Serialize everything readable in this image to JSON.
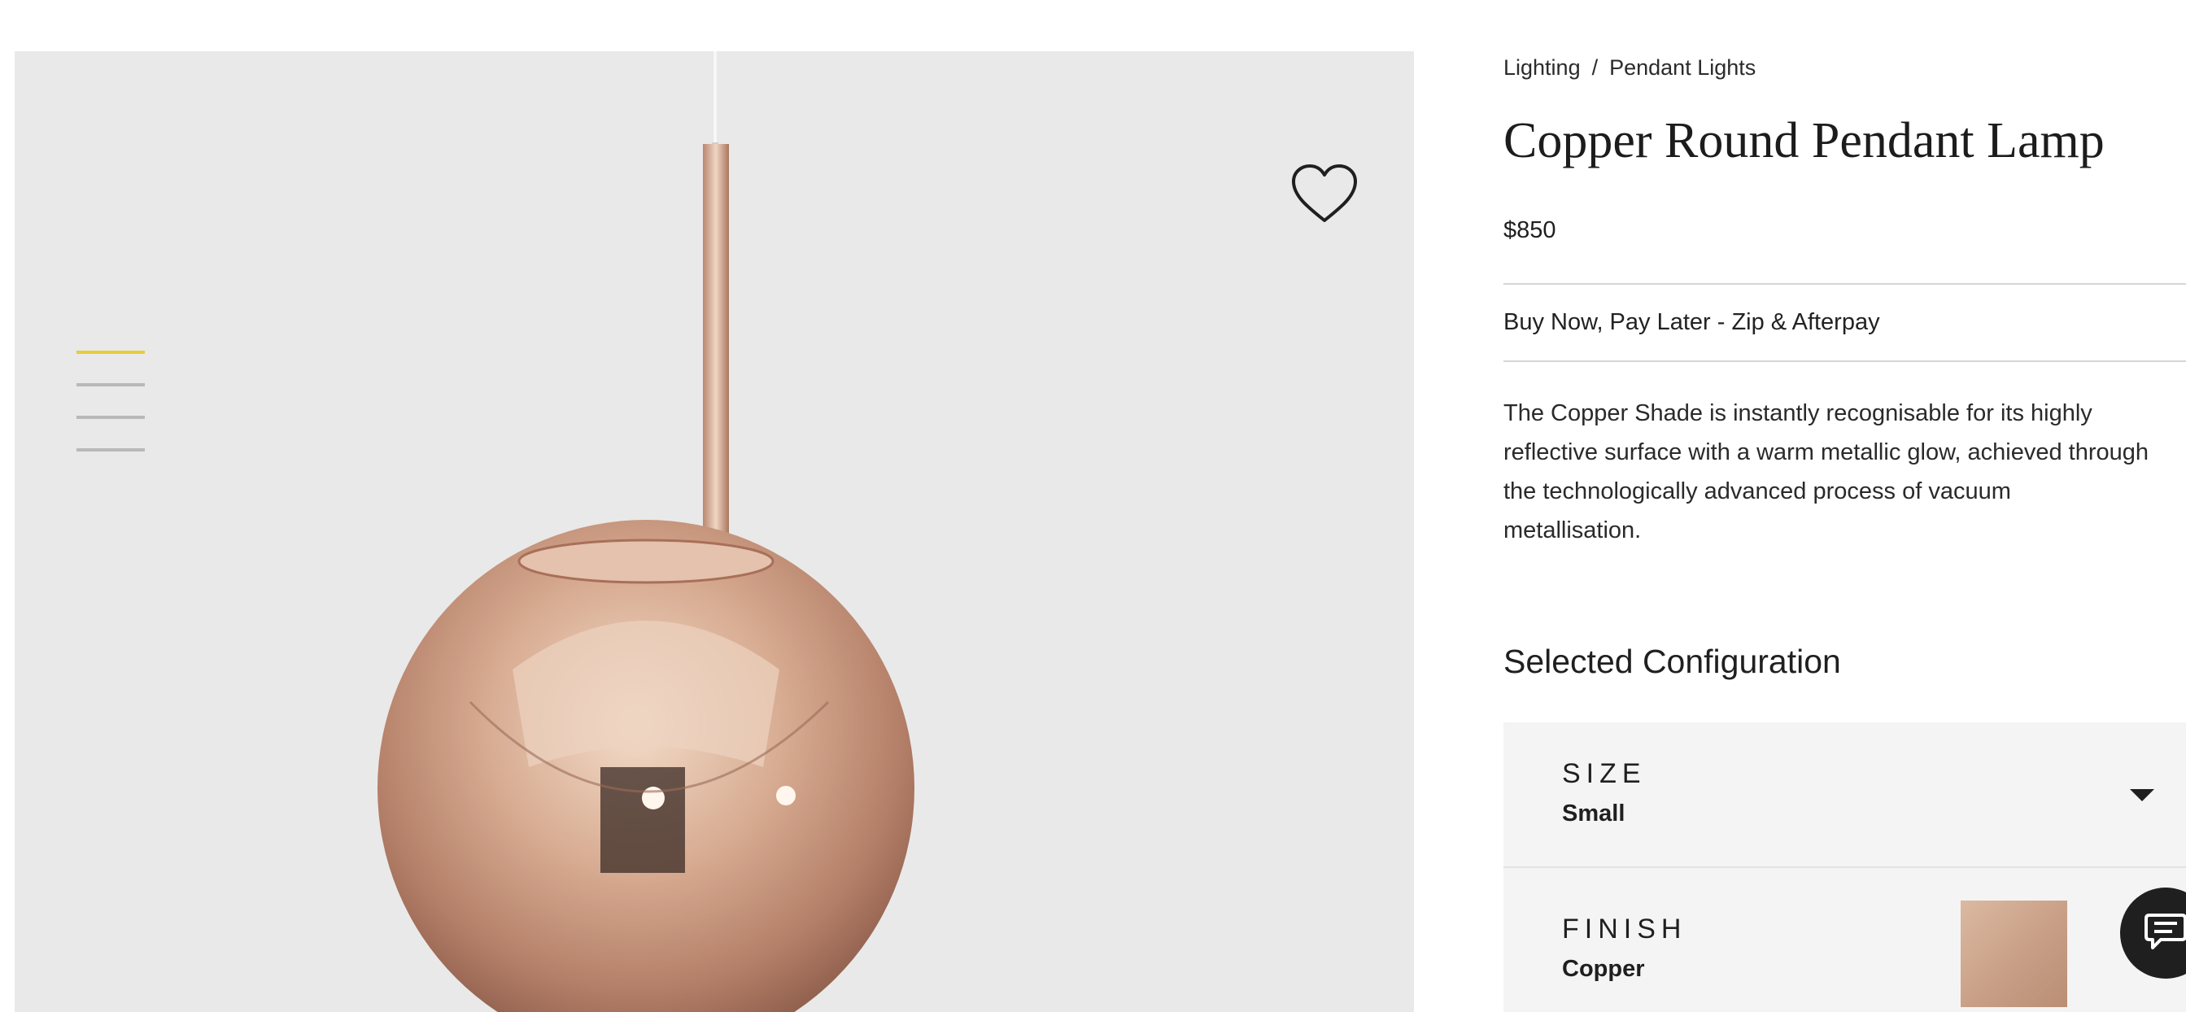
{
  "breadcrumb": {
    "category": "Lighting",
    "separator": "/",
    "subcategory": "Pendant Lights"
  },
  "product": {
    "title": "Copper Round Pendant Lamp",
    "price": "$850",
    "finance_link": "Buy Now, Pay Later - Zip & Afterpay",
    "description": "The Copper Shade is instantly recognisable for its highly reflective surface with a warm metallic glow, achieved through the technologically advanced process of vacuum metallisation."
  },
  "gallery": {
    "wishlist_icon": "heart-outline-icon",
    "image_count": 4,
    "active_image": 1,
    "accent_color": "#e6cd3c"
  },
  "configuration": {
    "heading": "Selected Configuration",
    "size": {
      "label": "SIZE",
      "value": "Small",
      "icon": "caret-down-icon"
    },
    "finish": {
      "label": "FINISH",
      "value": "Copper",
      "swatch_color": "#c9a189"
    }
  },
  "chat": {
    "icon": "chat-bubble-icon"
  }
}
